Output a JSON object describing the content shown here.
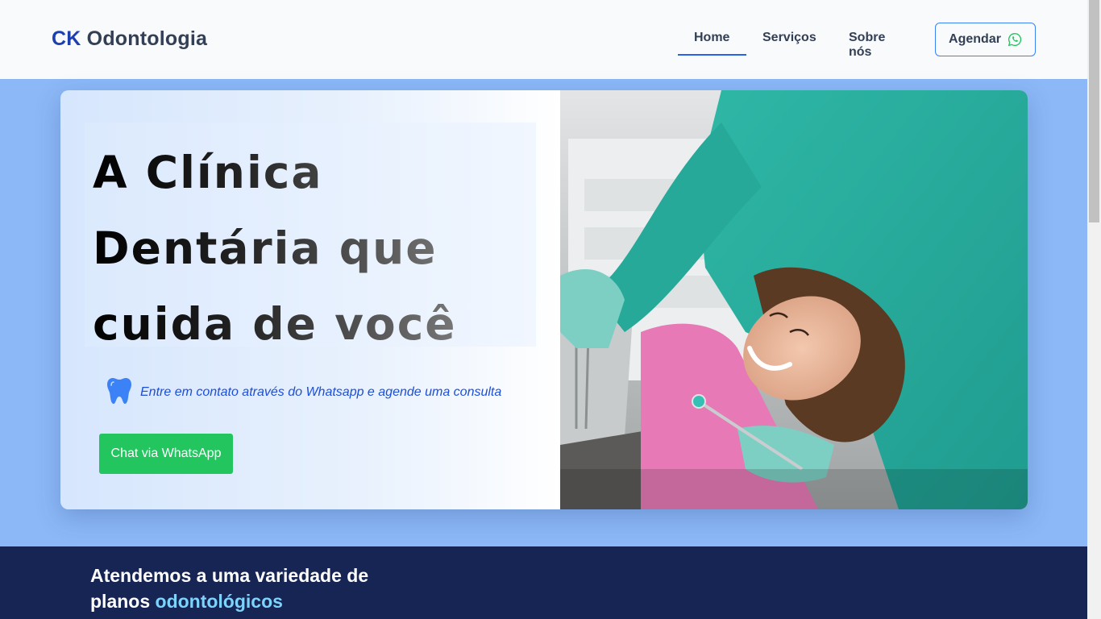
{
  "navbar": {
    "brand_prefix": "CK",
    "brand_suffix": "Odontologia",
    "items": [
      {
        "label": "Home",
        "active": true
      },
      {
        "label": "Serviços"
      },
      {
        "label": "Sobre nós"
      }
    ],
    "cta_label": "Agendar",
    "cta_icon": "whatsapp-icon"
  },
  "hero": {
    "headline_line1": "A Clínica",
    "headline_line2": "Dentária que",
    "headline_line3": "cuida de você",
    "tagline": "Entre em contato através do Whatsapp e agende uma consulta",
    "tagline_icon": "tooth-icon",
    "button_label": "Chat via WhatsApp",
    "photo": "dentist-with-smiling-patient-photo"
  },
  "plans": {
    "title_line1": "Atendemos a uma variedade de",
    "title_line2_prefix": "planos",
    "title_line2_highlight": "odontológicos"
  },
  "colors": {
    "brand_blue": "#1e40af",
    "accent_blue": "#2563eb",
    "whatsapp_green": "#22c55e",
    "page_bg": "#8cb8f7",
    "section_dark": "#172554"
  }
}
